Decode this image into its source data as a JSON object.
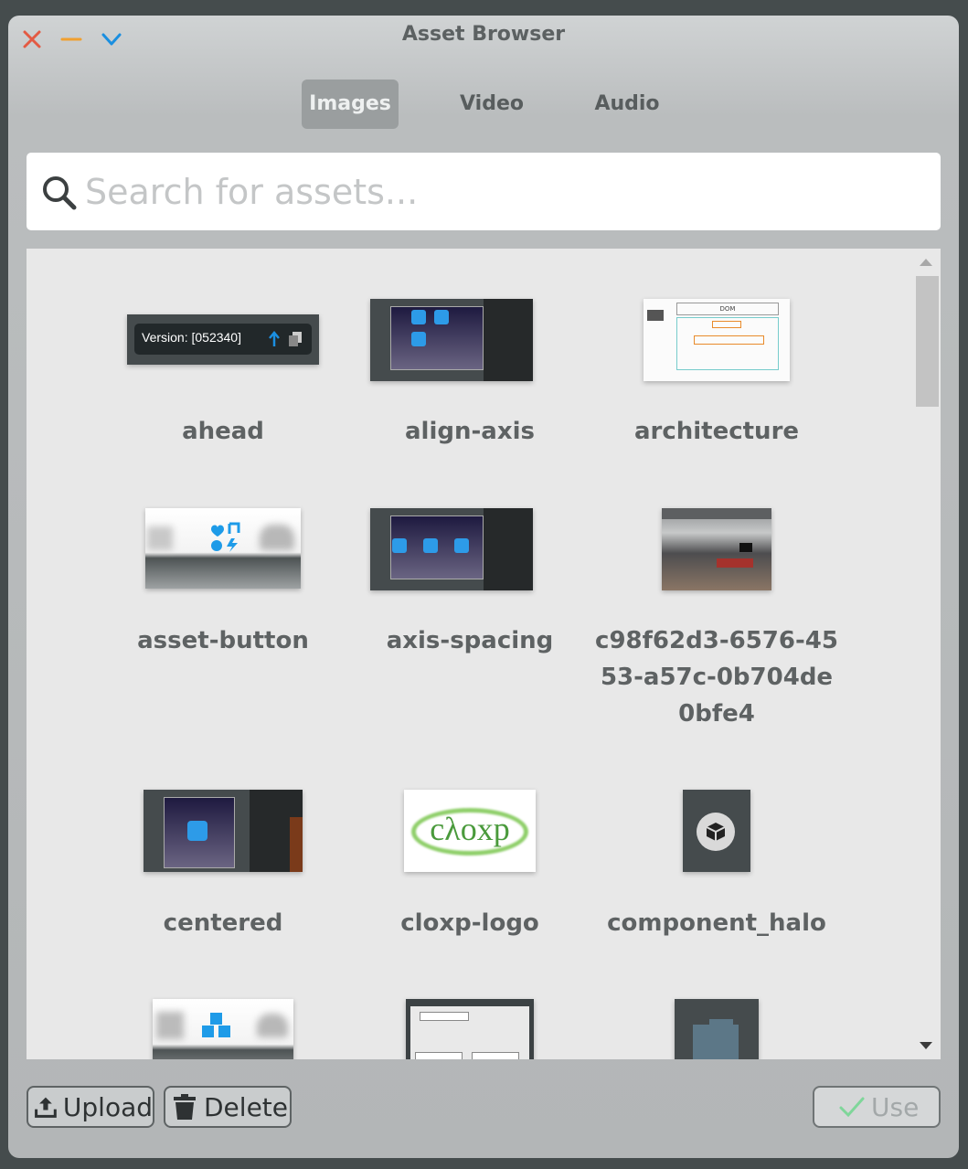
{
  "window": {
    "title": "Asset Browser",
    "controls": {
      "close_color": "#e35a43",
      "minimize_color": "#f0a030",
      "collapse_color": "#1a8fe0"
    }
  },
  "tabs": [
    {
      "label": "Images",
      "active": true
    },
    {
      "label": "Video",
      "active": false
    },
    {
      "label": "Audio",
      "active": false
    }
  ],
  "search": {
    "placeholder": "Search for assets...",
    "value": ""
  },
  "assets": [
    {
      "name": "ahead",
      "icon": "version-badge-thumbnail",
      "thumb_text": "Version: [052340]"
    },
    {
      "name": "align-axis",
      "icon": "editor-screenshot-thumbnail"
    },
    {
      "name": "architecture",
      "icon": "diagram-thumbnail",
      "thumb_text": "DOM"
    },
    {
      "name": "asset-button",
      "icon": "asset-button-thumbnail"
    },
    {
      "name": "axis-spacing",
      "icon": "editor-screenshot-thumbnail"
    },
    {
      "name": "c98f62d3-6576-4553-a57c-0b704de0bfe4",
      "icon": "office-photo-thumbnail"
    },
    {
      "name": "centered",
      "icon": "editor-screenshot-thumbnail"
    },
    {
      "name": "cloxp-logo",
      "icon": "cloxp-logo-thumbnail",
      "thumb_text": "cλoxp"
    },
    {
      "name": "component_halo",
      "icon": "component-halo-thumbnail"
    },
    {
      "name": "",
      "icon": "cubes-thumbnail"
    },
    {
      "name": "",
      "icon": "flow-diagram-thumbnail"
    },
    {
      "name": "",
      "icon": "dark-canvas-thumbnail"
    }
  ],
  "footer": {
    "upload_label": "Upload",
    "delete_label": "Delete",
    "use_label": "Use",
    "use_enabled": false
  },
  "colors": {
    "accent": "#1b8fe0",
    "active_tab_bg": "#9a9e9f",
    "check_green": "#7fd69a"
  }
}
